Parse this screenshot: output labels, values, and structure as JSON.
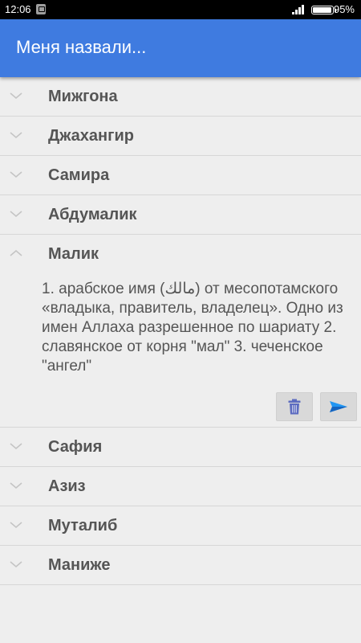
{
  "status_bar": {
    "time": "12:06",
    "battery_percent": "95%",
    "app_icon": "notification-icon",
    "signal_icon": "signal-icon",
    "battery_icon": "battery-icon"
  },
  "app_bar": {
    "title": "Меня назвали..."
  },
  "colors": {
    "accent": "#3f7be0",
    "background": "#eeeeee",
    "text": "#555555",
    "delete_icon": "#5c6bc0",
    "send_icon": "#2196f3"
  },
  "names_top": [
    {
      "label": "Мижгона",
      "expanded": false
    },
    {
      "label": "Джахангир",
      "expanded": false
    },
    {
      "label": "Самира",
      "expanded": false
    },
    {
      "label": "Абдумалик",
      "expanded": false
    }
  ],
  "expanded_item": {
    "label": "Малик",
    "expanded": true,
    "description": "1. арабское имя (مالك) от месопотамского «владыка, правитель, владелец». Одно из имен Аллаха разрешенное по шариату 2. славянское от корня \"мал\" 3. чеченское \"ангел\"",
    "actions": [
      {
        "name": "delete",
        "icon": "trash-icon"
      },
      {
        "name": "send",
        "icon": "send-icon"
      }
    ]
  },
  "names_bottom": [
    {
      "label": "Сафия",
      "expanded": false
    },
    {
      "label": "Азиз",
      "expanded": false
    },
    {
      "label": "Муталиб",
      "expanded": false
    },
    {
      "label": "Маниже",
      "expanded": false
    }
  ]
}
